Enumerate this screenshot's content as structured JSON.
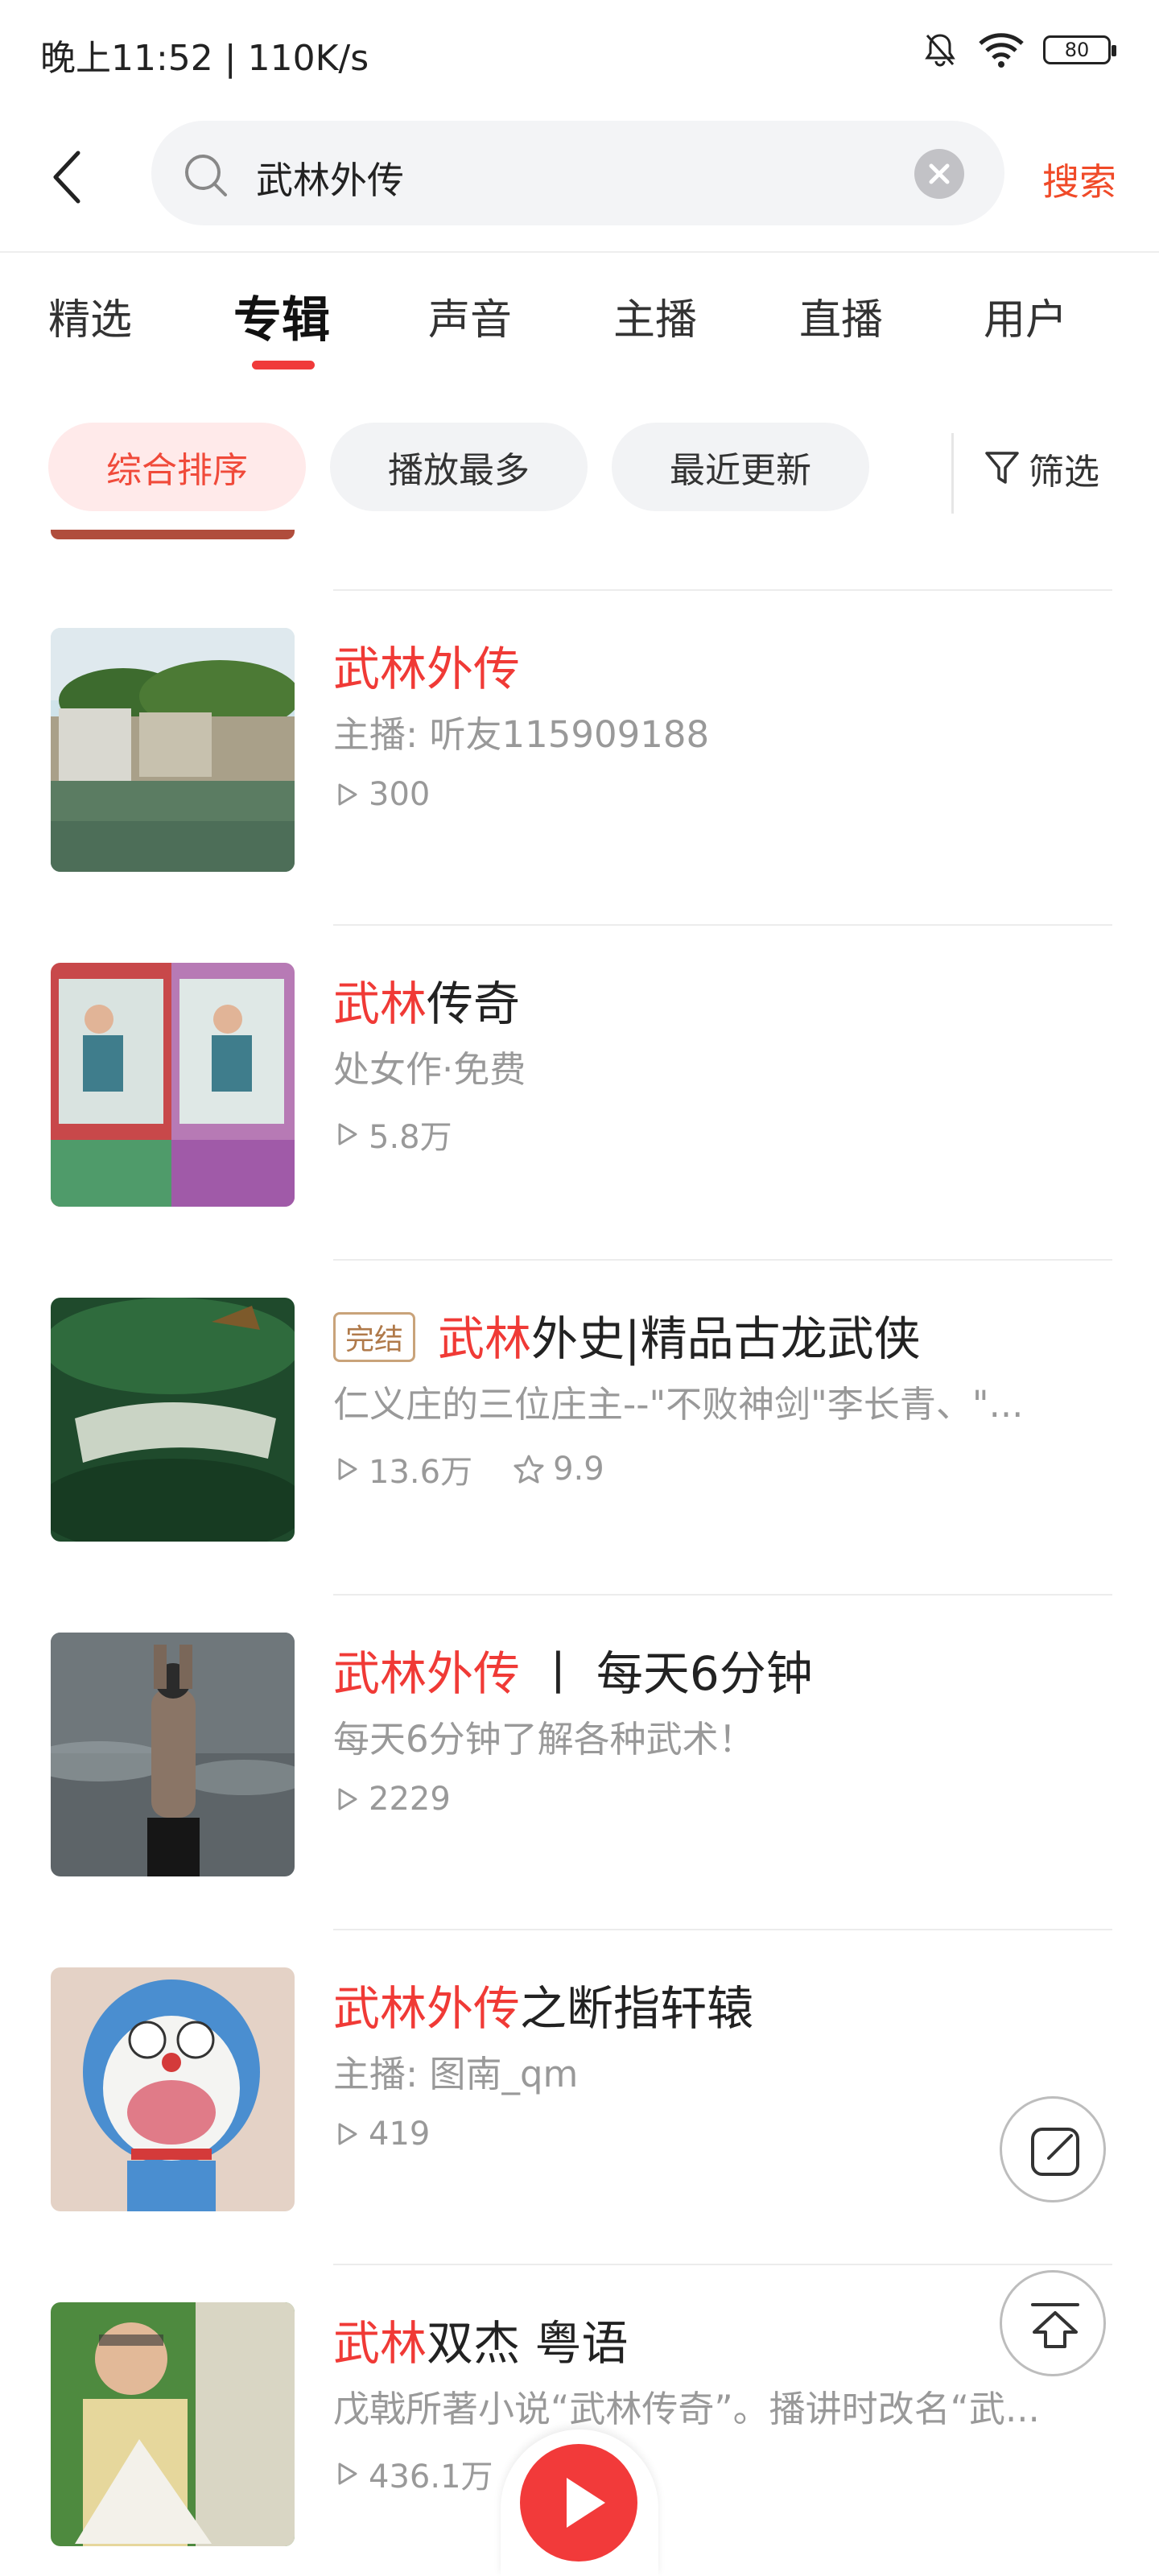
{
  "status_bar": {
    "time": "晚上11:52 | 110K/s",
    "battery": "80"
  },
  "search": {
    "query": "武林外传",
    "submit_label": "搜索"
  },
  "tabs": [
    {
      "label": "精选"
    },
    {
      "label": "专辑"
    },
    {
      "label": "声音"
    },
    {
      "label": "主播"
    },
    {
      "label": "直播"
    },
    {
      "label": "用户"
    }
  ],
  "active_tab": "专辑",
  "sort_options": [
    {
      "label": "综合排序"
    },
    {
      "label": "播放最多"
    },
    {
      "label": "最近更新"
    }
  ],
  "filter_label": "筛选",
  "results": [
    {
      "title_hl": "武林外传",
      "title_rest": "",
      "badge": "",
      "subtitle": "主播: 听友115909188",
      "plays": "300",
      "rating": ""
    },
    {
      "title_hl": "武林",
      "title_rest": "传奇",
      "badge": "",
      "subtitle": "处女作·免费",
      "plays": "5.8万",
      "rating": ""
    },
    {
      "title_hl": "武林",
      "title_rest": "外史|精品古龙武侠",
      "badge": "完结",
      "subtitle": "仁义庄的三位庄主--\"不败神剑\"李长青、\"...",
      "plays": "13.6万",
      "rating": "9.9"
    },
    {
      "title_hl": "武林外传",
      "title_rest": " 丨 每天6分钟",
      "badge": "",
      "subtitle": "每天6分钟了解各种武术！",
      "plays": "2229",
      "rating": ""
    },
    {
      "title_hl": "武林外传",
      "title_rest": "之断指轩辕",
      "badge": "",
      "subtitle": "主播: 图南_qm",
      "plays": "419",
      "rating": ""
    },
    {
      "title_hl": "武林",
      "title_rest": "双杰 粤语",
      "badge": "",
      "subtitle": "戊戟所著小说“武林传奇”。播讲时改名“武...",
      "plays": "436.1万",
      "rating": ""
    }
  ],
  "colors": {
    "accent": "#f03a36",
    "search_accent": "#f04a28"
  }
}
